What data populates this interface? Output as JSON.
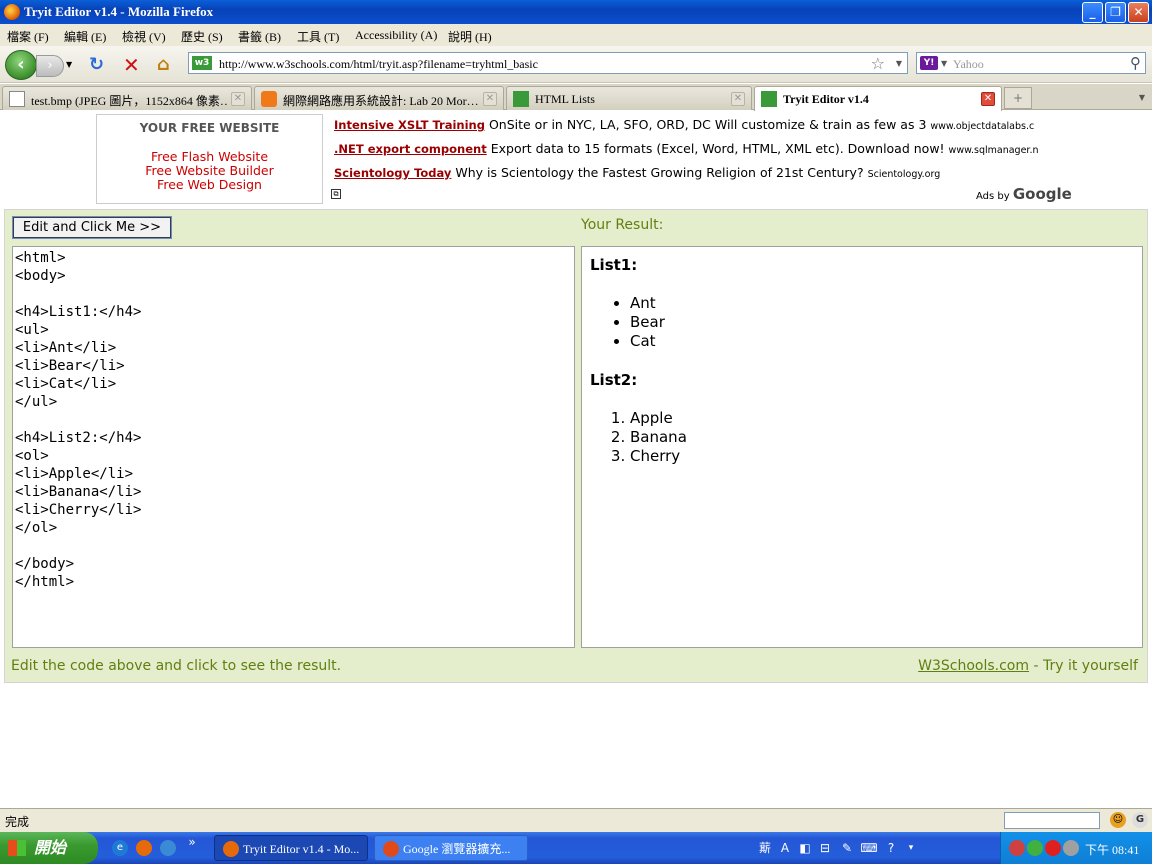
{
  "window": {
    "title": "Tryit Editor v1.4 - Mozilla Firefox"
  },
  "menu": [
    "檔案 (F)",
    "編輯 (E)",
    "檢視 (V)",
    "歷史 (S)",
    "書籤 (B)",
    "工具 (T)",
    "Accessibility (A)",
    "說明 (H)"
  ],
  "nav": {
    "url": "http://www.w3schools.com/html/tryit.asp?filename=tryhtml_basic",
    "search_placeholder": "Yahoo"
  },
  "tabs": [
    {
      "label": "test.bmp (JPEG 圖片，1152x864 像素…",
      "active": false
    },
    {
      "label": "網際網路應用系統設計: Lab 20 Mor…",
      "active": false
    },
    {
      "label": "HTML Lists",
      "active": false
    },
    {
      "label": "Tryit Editor v1.4",
      "active": true
    }
  ],
  "promo": {
    "title": "YOUR FREE WEBSITE",
    "links": [
      "Free Flash Website",
      "Free Website Builder",
      "Free Web Design"
    ]
  },
  "ads": [
    {
      "title": "Intensive XSLT Training",
      "text": "OnSite or in NYC, LA, SFO, ORD, DC Will customize & train as few as 3",
      "url": "www.objectdatalabs.c"
    },
    {
      "title": ".NET export component",
      "text": "Export data to 15 formats (Excel, Word, HTML, XML etc). Download now!",
      "url": "www.sqlmanager.n"
    },
    {
      "title": "Scientology Today",
      "text": "Why is Scientology the Fastest Growing Religion of 21st Century?",
      "url": "Scientology.org"
    }
  ],
  "ads_by": {
    "prefix": "Ads by",
    "brand": "Google"
  },
  "tryit": {
    "button": "Edit and Click Me >>",
    "result_label": "Your Result:",
    "code": "<html>\n<body>\n\n<h4>List1:</h4>\n<ul>\n<li>Ant</li>\n<li>Bear</li>\n<li>Cat</li>\n</ul>\n\n<h4>List2:</h4>\n<ol>\n<li>Apple</li>\n<li>Banana</li>\n<li>Cherry</li>\n</ol>\n\n</body>\n</html>",
    "result": {
      "list1_title": "List1:",
      "list1": [
        "Ant",
        "Bear",
        "Cat"
      ],
      "list2_title": "List2:",
      "list2": [
        "Apple",
        "Banana",
        "Cherry"
      ]
    },
    "footer_left": "Edit the code above and click to see the result.",
    "footer_link": "W3Schools.com",
    "footer_suffix": " - Try it yourself"
  },
  "status": {
    "text": "完成"
  },
  "taskbar": {
    "start": "開始",
    "tasks": [
      "Tryit Editor v1.4 - Mo...",
      "Google 瀏覽器擴充..."
    ],
    "clock": "下午 08:41"
  }
}
